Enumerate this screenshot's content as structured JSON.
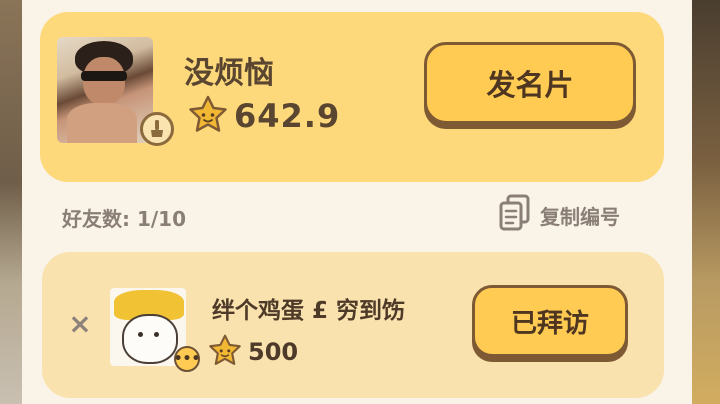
{
  "my_card": {
    "name": "没烦恼",
    "score": "642.9",
    "send_card_button": "发名片"
  },
  "friends": {
    "count_label": "好友数: 1/10",
    "copy_id_label": "复制编号"
  },
  "friend_list": [
    {
      "name": "绊个鸡蛋 £ 穷到饬",
      "score": "500",
      "visit_button": "已拜访",
      "remove_symbol": "×"
    }
  ],
  "colors": {
    "panel_bg": "#faf3e8",
    "my_card_bg": "#fed97b",
    "friend_card_bg": "#fae2af",
    "button_fill": "#ffcb52",
    "button_border": "#7e5a34",
    "text_dark": "#5a4530",
    "text_muted": "#8a7f76"
  },
  "icons": {
    "star": "star-face-icon",
    "brush": "brush-icon",
    "copy": "copy-document-icon",
    "more": "more-dots-icon",
    "remove": "close-icon"
  }
}
